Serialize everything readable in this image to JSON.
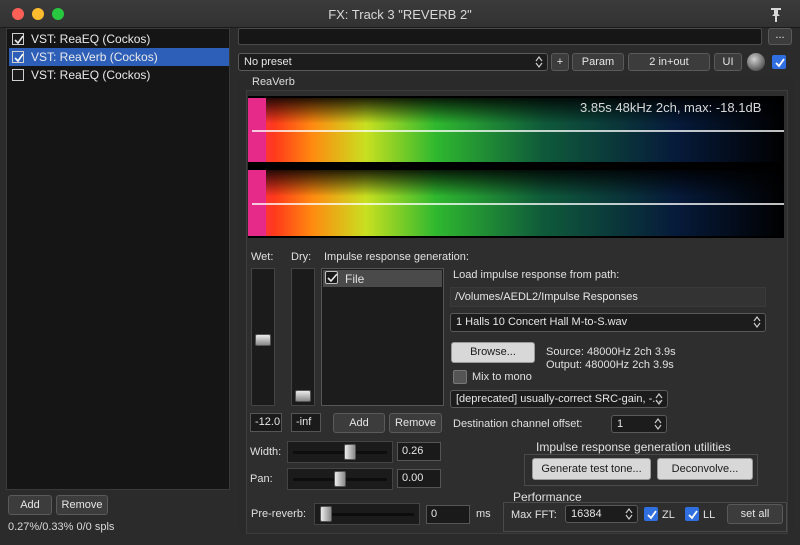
{
  "window": {
    "title": "FX: Track 3 \"REVERB 2\""
  },
  "fx_chain": {
    "items": [
      {
        "label": "VST: ReaEQ (Cockos)",
        "enabled": true,
        "selected": false
      },
      {
        "label": "VST: ReaVerb (Cockos)",
        "enabled": true,
        "selected": true
      },
      {
        "label": "VST: ReaEQ (Cockos)",
        "enabled": false,
        "selected": false
      }
    ],
    "add_label": "Add",
    "remove_label": "Remove",
    "status": "0.27%/0.33% 0/0 spls"
  },
  "toolbar": {
    "more_label": "...",
    "preset": "No preset",
    "plus_label": "+",
    "param_label": "Param",
    "io_label": "2 in+out",
    "ui_label": "UI"
  },
  "plugin": {
    "name": "ReaVerb",
    "ir_info": "3.85s 48kHz 2ch, max: -18.1dB",
    "wet_label": "Wet:",
    "dry_label": "Dry:",
    "wet_value": "-12.0",
    "dry_value": "-inf",
    "ir_gen_label": "Impulse response generation:",
    "ir_list": [
      {
        "label": "File",
        "enabled": true
      }
    ],
    "add_label": "Add",
    "remove_label": "Remove",
    "load_path_label": "Load impulse response from path:",
    "path_value": "/Volumes/AEDL2/Impulse Responses",
    "file_select": "1 Halls 10 Concert Hall  M-to-S.wav",
    "browse_label": "Browse...",
    "source_info": "Source: 48000Hz 2ch 3.9s",
    "output_info": "Output: 48000Hz 2ch 3.9s",
    "mix_to_mono_label": "Mix to mono",
    "mix_to_mono": false,
    "src_mode": "[deprecated] usually-correct SRC-gain, -...",
    "dest_offset_label": "Destination channel offset:",
    "dest_offset_value": "1",
    "width_label": "Width:",
    "width_value": "0.26",
    "pan_label": "Pan:",
    "pan_value": "0.00",
    "utils_label": "Impulse response generation utilities",
    "gen_tone_label": "Generate test tone...",
    "deconvolve_label": "Deconvolve...",
    "prereverb_label": "Pre-reverb:",
    "prereverb_value": "0",
    "ms_label": "ms",
    "performance_label": "Performance",
    "maxfft_label": "Max FFT:",
    "maxfft_value": "16384",
    "zl_label": "ZL",
    "zl_checked": true,
    "ll_label": "LL",
    "ll_checked": true,
    "setall_label": "set all"
  },
  "icons": {
    "pin": "pin-icon",
    "knob": "knob-icon",
    "checkmark": "checkmark-icon",
    "updown": "updown-arrows-icon"
  }
}
